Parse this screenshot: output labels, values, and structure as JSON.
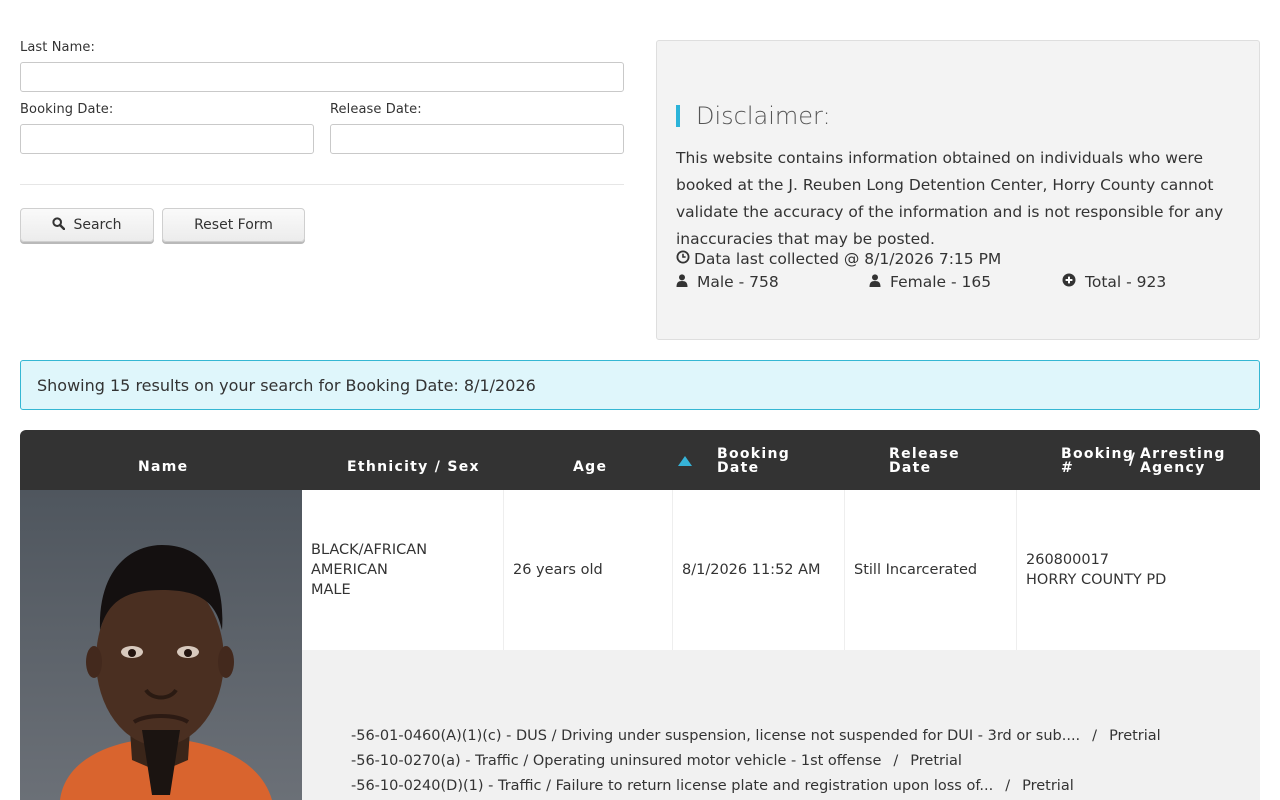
{
  "search_form": {
    "last_name_label": "Last Name:",
    "last_name_value": "",
    "booking_date_label": "Booking Date:",
    "booking_date_value": "",
    "release_date_label": "Release Date:",
    "release_date_value": "",
    "search_label": "Search",
    "reset_label": "Reset Form"
  },
  "disclaimer": {
    "title": "Disclaimer:",
    "text": "This website contains information obtained on individuals who were booked at the J. Reuben Long Detention Center, Horry County cannot validate the accuracy of the information and is not responsible for any inaccuracies that may be posted.",
    "collected": "Data last collected @ 8/1/2026 7:15 PM",
    "male": "Male - 758",
    "female": "Female - 165",
    "total": "Total - 923"
  },
  "alert": {
    "text": "Showing 15 results on your search for Booking Date: 8/1/2026"
  },
  "table": {
    "headers": {
      "name": "Name",
      "ethnicity_sex": "Ethnicity / Sex",
      "age": "Age",
      "booking_date_1": "Booking",
      "booking_date_2": "Date",
      "release_date_1": "Release",
      "release_date_2": "Date",
      "booking_num_1": "Booking",
      "booking_num_2": "#",
      "slash": "/",
      "agency_1": "Arresting",
      "agency_2": "Agency"
    },
    "rows": [
      {
        "ethnicity": "BLACK/AFRICAN AMERICAN",
        "sex": "MALE",
        "age": "26 years old",
        "booking_date": "8/1/2026 11:52 AM",
        "release_date": "Still Incarcerated",
        "booking_number": "260800017",
        "agency": "HORRY COUNTY PD",
        "charges": [
          {
            "description": "-56-01-0460(A)(1)(c) - DUS / Driving under suspension, license not suspended for DUI - 3rd or sub....",
            "status": "Pretrial"
          },
          {
            "description": "-56-10-0270(a) - Traffic / Operating uninsured motor vehicle - 1st offense",
            "status": "Pretrial"
          },
          {
            "description": "-56-10-0240(D)(1) - Traffic / Failure to return license plate and registration upon loss of...",
            "status": "Pretrial"
          }
        ]
      }
    ]
  },
  "colors": {
    "accent": "#2bb3d9",
    "header_bg": "#333333",
    "alert_bg": "#dff6fb",
    "panel_bg": "#f3f3f3"
  }
}
